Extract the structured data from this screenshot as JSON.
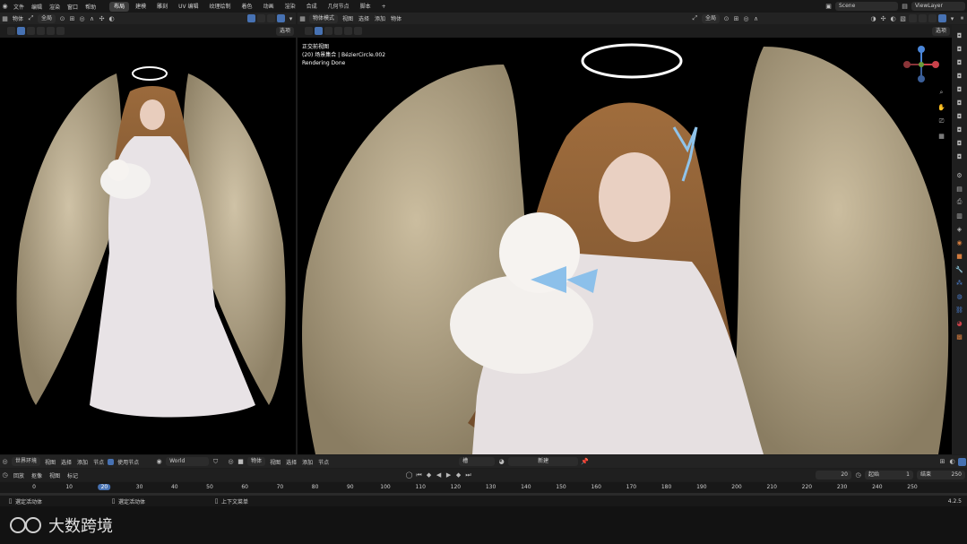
{
  "topbar": {
    "menus": [
      "文件",
      "编辑",
      "渲染",
      "窗口",
      "帮助"
    ],
    "tabs": [
      "布局",
      "建模",
      "雕刻",
      "UV 编辑",
      "纹理绘制",
      "着色",
      "动画",
      "渲染",
      "合成",
      "几何节点",
      "脚本"
    ],
    "active_tab": "布局",
    "add_tab": "+",
    "scene_label": "Scene",
    "viewlayer_label": "ViewLayer"
  },
  "left_view": {
    "mode": "物体",
    "orientation": "全局",
    "options": "选项"
  },
  "right_view": {
    "mode": "物体模式",
    "menus": [
      "视图",
      "选择",
      "添加",
      "物体"
    ],
    "orientation": "全局",
    "options": "选项",
    "overlay_title": "正交前视图",
    "overlay_collection": "(20) 场景集合 | BézierCircle.002",
    "overlay_status": "Rendering Done"
  },
  "node_editor": {
    "mode": "世界环境",
    "menus": [
      "视图",
      "选择",
      "添加",
      "节点"
    ],
    "use_nodes": "使用节点",
    "world_name": "World",
    "obj_mode": "物体",
    "menus2": [
      "视图",
      "选择",
      "添加",
      "节点"
    ],
    "slot": "槽",
    "new_btn": "新建"
  },
  "timeline": {
    "menus": [
      "回放",
      "抠像",
      "视图",
      "标记"
    ],
    "current_frame": "20",
    "start_label": "起始",
    "start": "1",
    "end_label": "结束",
    "end": "250",
    "ticks": [
      "0",
      "10",
      "20",
      "30",
      "40",
      "50",
      "60",
      "70",
      "80",
      "90",
      "100",
      "110",
      "120",
      "130",
      "140",
      "150",
      "160",
      "170",
      "180",
      "190",
      "200",
      "210",
      "220",
      "230",
      "240",
      "250"
    ]
  },
  "statusbar": {
    "item1": "選定活动体",
    "item2": "選定活动体",
    "item3": "上下文菜单",
    "version": "4.2.5"
  },
  "watermark": {
    "text": "大数跨境"
  }
}
